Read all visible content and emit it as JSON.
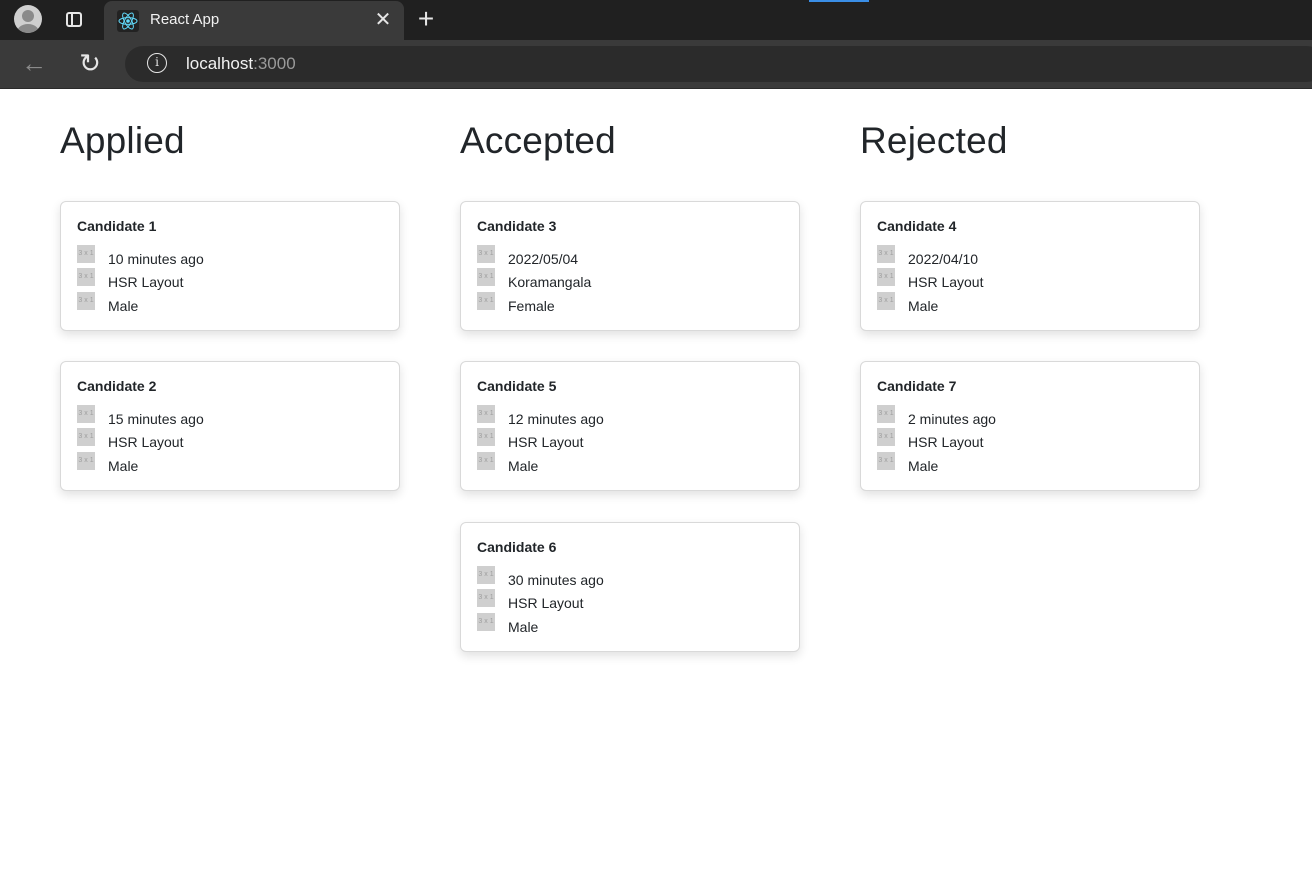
{
  "browser": {
    "tab_title": "React App",
    "url_host": "localhost",
    "url_port": ":3000"
  },
  "placeholder_text": "3 x 1",
  "columns": [
    {
      "title": "Applied",
      "cards": [
        {
          "name": "Candidate 1",
          "time": "10 minutes ago",
          "location": "HSR Layout",
          "gender": "Male"
        },
        {
          "name": "Candidate 2",
          "time": "15 minutes ago",
          "location": "HSR Layout",
          "gender": "Male"
        }
      ]
    },
    {
      "title": "Accepted",
      "cards": [
        {
          "name": "Candidate 3",
          "time": "2022/05/04",
          "location": "Koramangala",
          "gender": "Female"
        },
        {
          "name": "Candidate 5",
          "time": "12 minutes ago",
          "location": "HSR Layout",
          "gender": "Male"
        },
        {
          "name": "Candidate 6",
          "time": "30 minutes ago",
          "location": "HSR Layout",
          "gender": "Male"
        }
      ]
    },
    {
      "title": "Rejected",
      "cards": [
        {
          "name": "Candidate 4",
          "time": "2022/04/10",
          "location": "HSR Layout",
          "gender": "Male"
        },
        {
          "name": "Candidate 7",
          "time": "2 minutes ago",
          "location": "HSR Layout",
          "gender": "Male"
        }
      ]
    }
  ]
}
